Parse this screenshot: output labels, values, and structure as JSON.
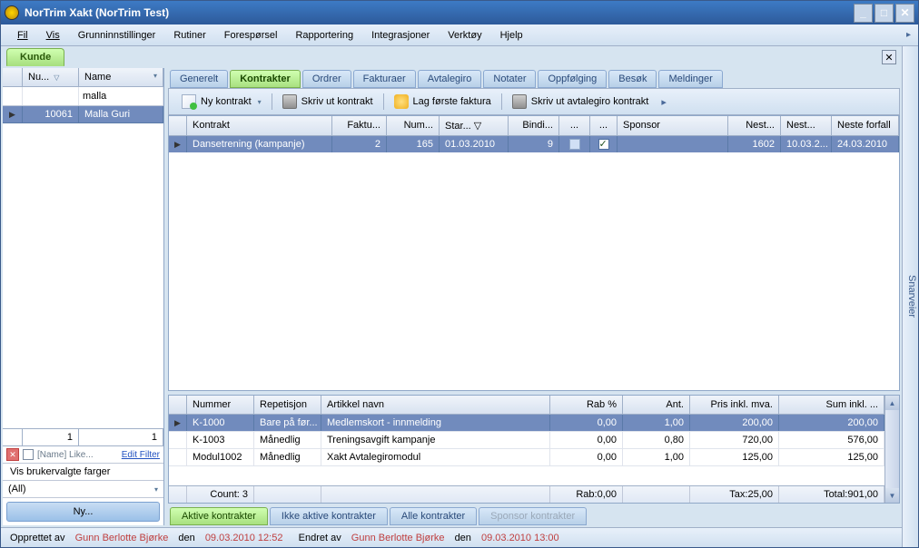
{
  "window": {
    "title": "NorTrim Xakt (NorTrim Test)"
  },
  "menu": {
    "items": [
      "Fil",
      "Vis",
      "Grunninnstillinger",
      "Rutiner",
      "Forespørsel",
      "Rapportering",
      "Integrasjoner",
      "Verktøy",
      "Hjelp"
    ]
  },
  "kunde_tab": "Kunde",
  "snarveier": "Snarveier",
  "left": {
    "headers": {
      "num": "Nu...",
      "name": "Name"
    },
    "filter": {
      "num": "",
      "name": "malla"
    },
    "row": {
      "num": "10061",
      "name": "Malla Guri"
    },
    "footer": {
      "a": "1",
      "b": "1"
    },
    "filter_text": "[Name] Like...",
    "edit_filter": "Edit Filter",
    "vis": "Vis brukervalgte farger",
    "all": "(All)",
    "ny": "Ny..."
  },
  "rtabs": [
    "Generelt",
    "Kontrakter",
    "Ordrer",
    "Fakturaer",
    "Avtalegiro",
    "Notater",
    "Oppfølging",
    "Besøk",
    "Meldinger"
  ],
  "toolbar": {
    "ny": "Ny kontrakt",
    "skriv": "Skriv ut kontrakt",
    "lag": "Lag første faktura",
    "avtale": "Skriv ut avtalegiro kontrakt"
  },
  "grid": {
    "headers": [
      "Kontrakt",
      "Faktu...",
      "Num...",
      "Star... ▽",
      "Bindi...",
      "...",
      "...",
      "Sponsor",
      "Nest...",
      "Nest...",
      "Neste forfall"
    ],
    "row": [
      "Dansetrening (kampanje)",
      "2",
      "165",
      "01.03.2010",
      "9",
      "",
      "",
      "",
      "1602",
      "10.03.2...",
      "24.03.2010"
    ]
  },
  "lower": {
    "headers": [
      "Nummer",
      "Repetisjon",
      "Artikkel navn",
      "Rab %",
      "Ant.",
      "Pris inkl. mva.",
      "Sum inkl. ..."
    ],
    "rows": [
      [
        "K-1000",
        "Bare på før...",
        "Medlemskort - innmelding",
        "0,00",
        "1,00",
        "200,00",
        "200,00"
      ],
      [
        "K-1003",
        "Månedlig",
        "Treningsavgift kampanje",
        "0,00",
        "0,80",
        "720,00",
        "576,00"
      ],
      [
        "Modul1002",
        "Månedlig",
        "Xakt Avtalegiromodul",
        "0,00",
        "1,00",
        "125,00",
        "125,00"
      ]
    ],
    "footer": {
      "count": "Count: 3",
      "rab": "Rab:0,00",
      "tax": "Tax:25,00",
      "total": "Total:901,00"
    }
  },
  "btabs": [
    "Aktive kontrakter",
    "Ikke aktive kontrakter",
    "Alle kontrakter",
    "Sponsor kontrakter"
  ],
  "status": {
    "opprettet": "Opprettet av",
    "av1": "Gunn Berlotte Bjørke",
    "den1": "den",
    "d1": "09.03.2010 12:52",
    "endret": "Endret av",
    "av2": "Gunn Berlotte Bjørke",
    "den2": "den",
    "d2": "09.03.2010 13:00"
  }
}
